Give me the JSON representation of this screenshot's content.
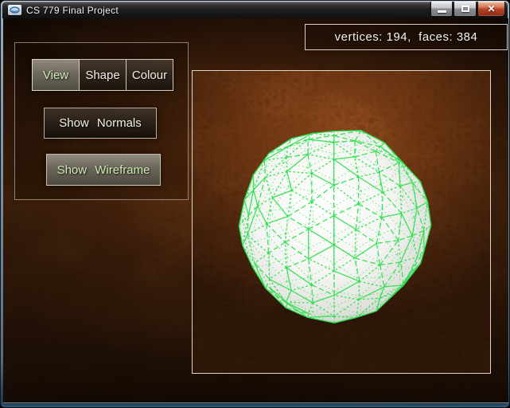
{
  "window": {
    "title": "CS 779 Final Project",
    "controls": {
      "minimize": "minimize",
      "maximize": "maximize",
      "close": "close",
      "close_glyph": "✕"
    }
  },
  "stats": {
    "vertices": 194,
    "faces": 384,
    "text": "vertices: 194,  faces: 384"
  },
  "panel": {
    "tabs": [
      {
        "label": "View",
        "active": true
      },
      {
        "label": "Shape",
        "active": false
      },
      {
        "label": "Colour",
        "active": false
      }
    ],
    "buttons": [
      {
        "label": "Show Normals",
        "active": false
      },
      {
        "label": "Show Wireframe",
        "active": true
      }
    ]
  },
  "colors": {
    "wireframe": "#2ce04e",
    "active_text": "#cdeab2",
    "label_text": "#f2efe8",
    "leather_accent": "#7c4218"
  }
}
